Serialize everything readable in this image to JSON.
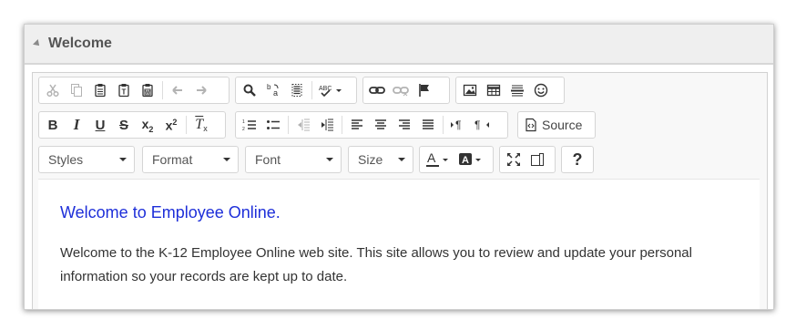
{
  "panel": {
    "title": "Welcome"
  },
  "toolbar": {
    "source_label": "Source",
    "help_label": "?",
    "combos": {
      "styles": "Styles",
      "format": "Format",
      "font": "Font",
      "size": "Size"
    }
  },
  "content": {
    "heading": "Welcome to Employee Online.",
    "paragraph": "Welcome to the K-12 Employee Online web site. This site allows you to review and update your personal information so your records are kept up to date."
  },
  "colors": {
    "heading": "#1e2fd9",
    "text": "#333333",
    "panel_header_bg": "#efefef"
  }
}
